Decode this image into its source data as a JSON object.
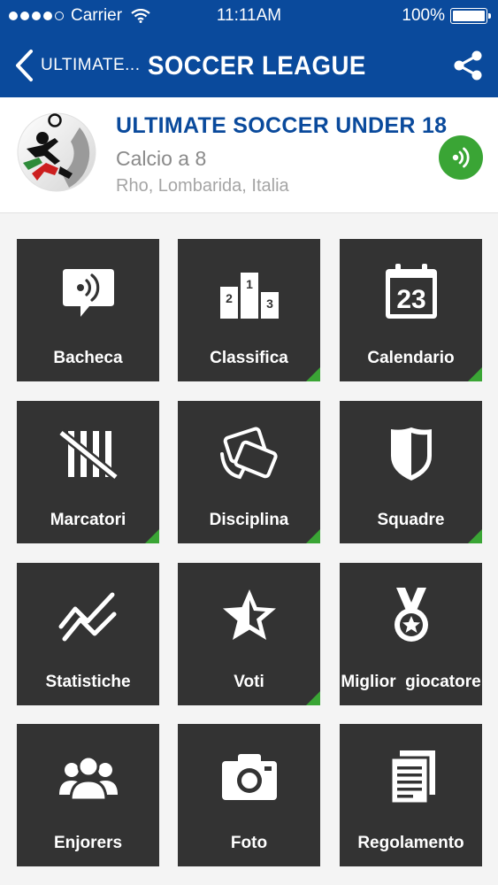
{
  "status_bar": {
    "carrier": "Carrier",
    "time": "11:11AM",
    "battery": "100%"
  },
  "nav": {
    "back_label": "ULTIMATE...",
    "title": "SOCCER LEAGUE"
  },
  "league": {
    "name": "ULTIMATE SOCCER UNDER 18",
    "type": "Calcio a 8",
    "location": "Rho, Lombarida, Italia"
  },
  "menu": [
    {
      "label": "Bacheca",
      "icon": "message-bubble-icon",
      "has_badge": false
    },
    {
      "label": "Classifica",
      "icon": "podium-icon",
      "has_badge": true,
      "podium": [
        "2",
        "1",
        "3"
      ]
    },
    {
      "label": "Calendario",
      "icon": "calendar-icon",
      "has_badge": true,
      "day": "23"
    },
    {
      "label": "Marcatori",
      "icon": "tally-icon",
      "has_badge": true
    },
    {
      "label": "Disciplina",
      "icon": "cards-icon",
      "has_badge": true
    },
    {
      "label": "Squadre",
      "icon": "shield-icon",
      "has_badge": true
    },
    {
      "label": "Statistiche",
      "icon": "stats-lines-icon",
      "has_badge": false
    },
    {
      "label": "Voti",
      "icon": "star-icon",
      "has_badge": true
    },
    {
      "label": "Miglior  giocatore",
      "icon": "medal-icon",
      "has_badge": false
    },
    {
      "label": "Enjorers",
      "icon": "people-icon",
      "has_badge": false
    },
    {
      "label": "Foto",
      "icon": "camera-icon",
      "has_badge": false
    },
    {
      "label": "Regolamento",
      "icon": "document-icon",
      "has_badge": false
    }
  ],
  "colors": {
    "brand_blue": "#0a4a9c",
    "tile": "#333333",
    "accent_green": "#3aa535"
  }
}
